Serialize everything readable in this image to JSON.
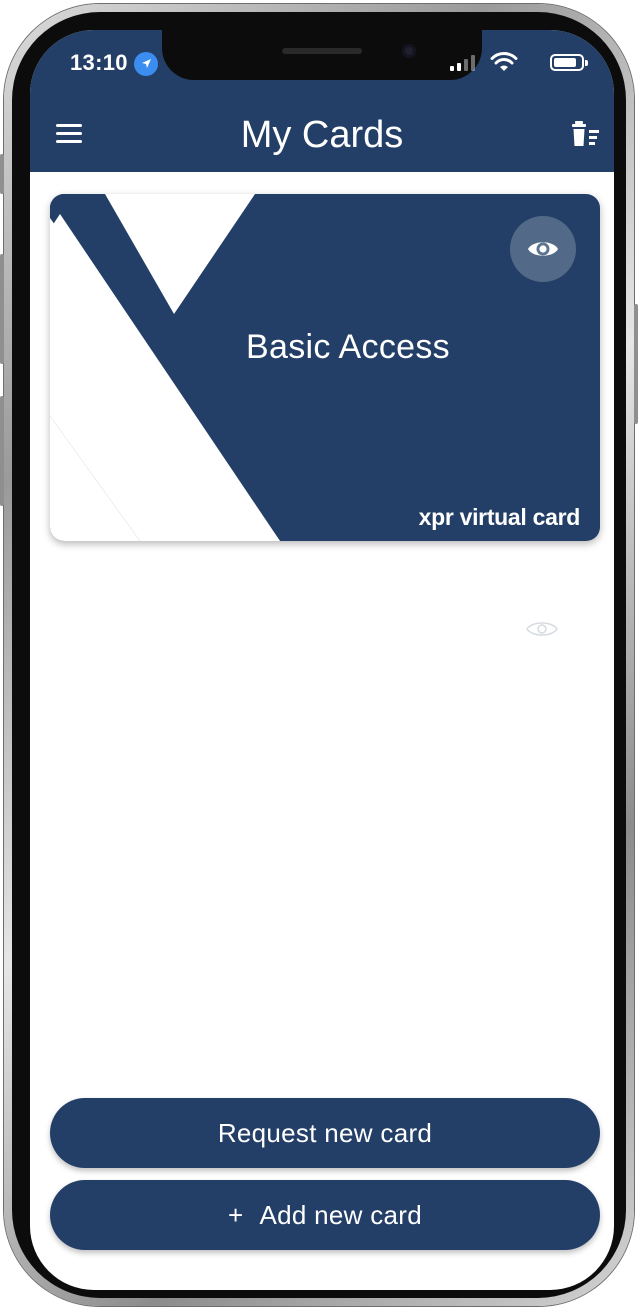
{
  "status_bar": {
    "time": "13:10",
    "location_icon": "location-arrow-icon",
    "signal_icon": "cellular-signal-icon",
    "wifi_icon": "wifi-icon",
    "battery_icon": "battery-icon"
  },
  "header": {
    "title": "My Cards",
    "menu_icon": "hamburger-menu-icon",
    "delete_icon": "trash-list-icon"
  },
  "cards": [
    {
      "name": "Basic Access",
      "brand": "xpr virtual card",
      "reveal_icon": "eye-icon"
    }
  ],
  "actions": {
    "request_label": "Request new card",
    "add_prefix": "+",
    "add_label": "Add new card"
  },
  "colors": {
    "primary": "#233f67",
    "background": "#ffffff",
    "text_on_primary": "#ffffff"
  }
}
